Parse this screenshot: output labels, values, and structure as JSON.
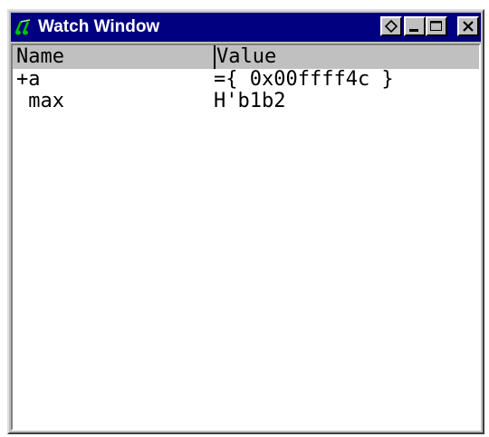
{
  "window": {
    "title": "Watch Window",
    "icon": "glasses-icon",
    "buttons": [
      "float-icon",
      "minimize-icon",
      "maximize-icon",
      "close-icon"
    ]
  },
  "table": {
    "columns": [
      "Name",
      "Value"
    ],
    "rows": [
      {
        "name": "+a",
        "value": "={ 0x00ffff4c }"
      },
      {
        "name": " max",
        "value": "H'b1b2"
      }
    ]
  },
  "colors": {
    "titlebar": "#000080",
    "titlebar_text": "#ffffff",
    "face": "#c0c0c0",
    "client": "#ffffff"
  }
}
